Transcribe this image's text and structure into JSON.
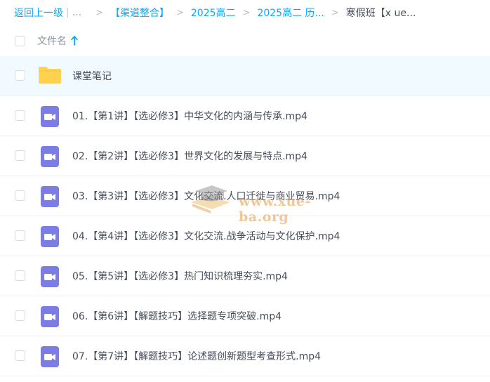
{
  "breadcrumb": {
    "back_label": "返回上一级",
    "ellipsis": "...",
    "items": [
      "【渠道整合】",
      "2025高二",
      "2025高二 历...",
      "寒假班【x ue..."
    ]
  },
  "header": {
    "column_label": "文件名"
  },
  "files": [
    {
      "name": "课堂笔记",
      "type": "folder"
    },
    {
      "name": "01.【第1讲】【选必修3】中华文化的内涵与传承.mp4",
      "type": "video"
    },
    {
      "name": "02.【第2讲】【选必修3】世界文化的发展与特点.mp4",
      "type": "video"
    },
    {
      "name": "03.【第3讲】【选必修3】文化交流.人口迁徙与商业贸易.mp4",
      "type": "video"
    },
    {
      "name": "04.【第4讲】【选必修3】文化交流.战争活动与文化保护.mp4",
      "type": "video"
    },
    {
      "name": "05.【第5讲】【选必修3】热门知识梳理夯实.mp4",
      "type": "video"
    },
    {
      "name": "06.【第6讲】【解题技巧】选择题专项突破.mp4",
      "type": "video"
    },
    {
      "name": "07.【第7讲】【解题技巧】论述题创新题型考查形式.mp4",
      "type": "video"
    }
  ],
  "watermark": {
    "text": "www.xue-ba.org"
  },
  "colors": {
    "accent": "#06a7ff",
    "folder": "#ffd34f",
    "video": "#7c7ce6",
    "highlight_row": "#f0faff"
  }
}
